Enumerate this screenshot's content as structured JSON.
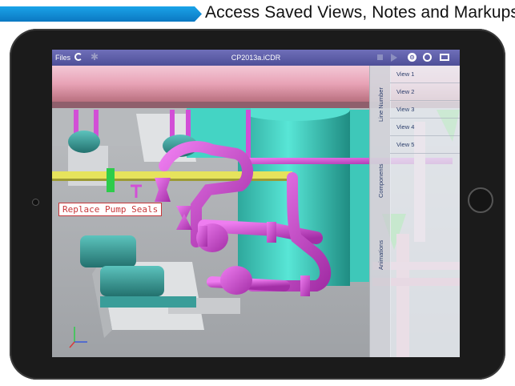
{
  "banner": {
    "caption": "Access Saved Views, Notes and Markups",
    "accent_color": "#1496de"
  },
  "toolbar": {
    "files_label": "Files",
    "file_name": "CP2013a.iCDR",
    "background": "#5a5ba6",
    "icons": [
      "refresh-icon",
      "settings-icon",
      "stop-icon",
      "play-icon",
      "view-icon",
      "markup-icon",
      "window-icon"
    ]
  },
  "side_panel": {
    "tabs": [
      {
        "label": "Line Number"
      },
      {
        "label": "Components"
      },
      {
        "label": "Animations"
      }
    ],
    "views": [
      {
        "label": "View 1"
      },
      {
        "label": "View 2"
      },
      {
        "label": "View 3"
      },
      {
        "label": "View 4"
      },
      {
        "label": "View 5"
      }
    ]
  },
  "annotation": {
    "text": "Replace Pump Seals",
    "color": "#c8373a"
  },
  "colors": {
    "pipe_magenta": "#d24fd6",
    "vessel_cyan": "#3fd3c4",
    "pipe_pink": "#e7a3b8",
    "pipe_yellow": "#e6e35c",
    "pump_teal": "#3a9d99"
  }
}
